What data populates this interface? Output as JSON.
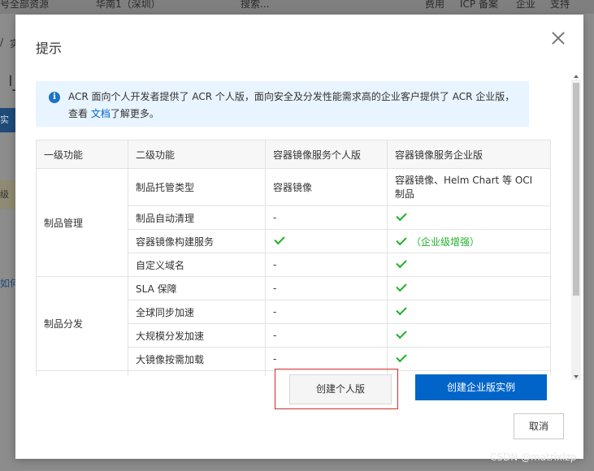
{
  "background": {
    "topbar": [
      "号全部资源",
      "华南1（深圳）",
      "搜索...",
      "费用",
      "ICP 备案",
      "企业",
      "支持"
    ],
    "side_texts": [
      "/",
      "实",
      "刂表",
      "实例",
      "级安",
      "如何"
    ]
  },
  "modal": {
    "title": "提示",
    "notice_text_pre": "ACR 面向个人开发者提供了 ACR 个人版，面向安全及分发性能需求高的企业客户提供了 ACR 企业版，查看",
    "notice_link": "文档",
    "notice_text_post": "了解更多。",
    "table": {
      "headers": [
        "一级功能",
        "二级功能",
        "容器镜像服务个人版",
        "容器镜像服务企业版"
      ],
      "groups": [
        {
          "name": "制品管理",
          "rows": [
            {
              "feature": "制品托管类型",
              "personal": "容器镜像",
              "enterprise_text": "容器镜像、Helm Chart 等 OCI 制品"
            },
            {
              "feature": "制品自动清理",
              "personal": "-",
              "enterprise_check": true
            },
            {
              "feature": "容器镜像构建服务",
              "personal_check": true,
              "enterprise_check": true,
              "enterprise_note": "（企业级增强）"
            },
            {
              "feature": "自定义域名",
              "personal": "-",
              "enterprise_check": true
            }
          ]
        },
        {
          "name": "制品分发",
          "rows": [
            {
              "feature": "SLA 保障",
              "personal": "-",
              "enterprise_check": true
            },
            {
              "feature": "全球同步加速",
              "personal": "-",
              "enterprise_check": true
            },
            {
              "feature": "大规模分发加速",
              "personal": "-",
              "enterprise_check": true
            },
            {
              "feature": "大镜像按需加载",
              "personal": "-",
              "enterprise_check": true
            }
          ]
        }
      ]
    },
    "buttons": {
      "personal": "创建个人版",
      "enterprise": "创建企业版实例",
      "cancel": "取消"
    }
  },
  "watermark": "CSDN @matrixlzp",
  "colors": {
    "primary": "#0064c8",
    "success": "#1eb128",
    "highlight": "#d42c2c",
    "notice_bg": "#e8f4ff"
  }
}
